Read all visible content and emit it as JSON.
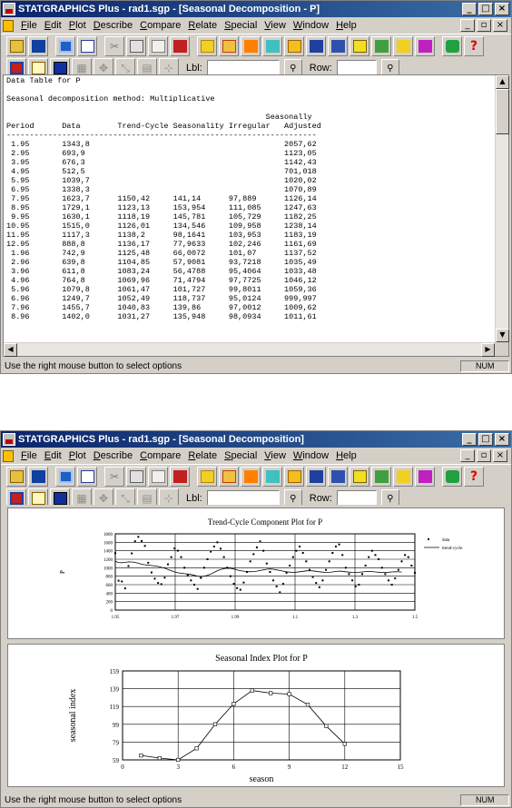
{
  "window1": {
    "title": "STATGRAPHICS Plus - rad1.sgp - [Seasonal Decomposition - P]",
    "status": "Use the right mouse button to select options",
    "num": "NUM"
  },
  "window2": {
    "title": "STATGRAPHICS Plus - rad1.sgp - [Seasonal Decomposition]",
    "status": "Use the right mouse button to select options",
    "num": "NUM"
  },
  "menu": [
    "File",
    "Edit",
    "Plot",
    "Describe",
    "Compare",
    "Relate",
    "Special",
    "View",
    "Window",
    "Help"
  ],
  "toolbar2": {
    "lbl": "Lbl:",
    "row": "Row:"
  },
  "text_table": {
    "title": "Data Table for P",
    "method": "Seasonal decomposition method: Multiplicative",
    "header1": "                                                        Seasonally",
    "header2": "Period      Data        Trend-Cycle Seasonality Irregular   Adjusted",
    "rule": "-------------------------------------------------------------------",
    "rows": [
      [
        " 1.95",
        "1343,8",
        "",
        "",
        "",
        "2057,62"
      ],
      [
        " 2.95",
        "693,9",
        "",
        "",
        "",
        "1123,05"
      ],
      [
        " 3.95",
        "676,3",
        "",
        "",
        "",
        "1142,43"
      ],
      [
        " 4.95",
        "512,5",
        "",
        "",
        "",
        "701,018"
      ],
      [
        " 5.95",
        "1039,7",
        "",
        "",
        "",
        "1020,02"
      ],
      [
        " 6.95",
        "1338,3",
        "",
        "",
        "",
        "1070,89"
      ],
      [
        " 7.95",
        "1623,7",
        "1150,42",
        "141,14",
        "97,889",
        "1126,14"
      ],
      [
        " 8.95",
        "1729,1",
        "1123,13",
        "153,954",
        "111,085",
        "1247,63"
      ],
      [
        " 9.95",
        "1630,1",
        "1118,19",
        "145,781",
        "105,729",
        "1182,25"
      ],
      [
        "10.95",
        "1515,0",
        "1126,01",
        "134,546",
        "109,958",
        "1238,14"
      ],
      [
        "11.95",
        "1117,3",
        "1138,2",
        "98,1641",
        "103,953",
        "1183,19"
      ],
      [
        "12.95",
        "888,8",
        "1136,17",
        "77,9633",
        "102,246",
        "1161,69"
      ],
      [
        " 1.96",
        "742,9",
        "1125,48",
        "66,0072",
        "101,07",
        "1137,52"
      ],
      [
        " 2.96",
        "639,8",
        "1104,85",
        "57,9081",
        "93,7218",
        "1035,49"
      ],
      [
        " 3.96",
        "611,8",
        "1083,24",
        "56,4788",
        "95,4064",
        "1033,48"
      ],
      [
        " 4.96",
        "764,8",
        "1069,96",
        "71,4794",
        "97,7725",
        "1046,12"
      ],
      [
        " 5.96",
        "1079,8",
        "1061,47",
        "101,727",
        "99,8011",
        "1059,36"
      ],
      [
        " 6.96",
        "1249,7",
        "1052,49",
        "118,737",
        "95,0124",
        "999,997"
      ],
      [
        " 7.96",
        "1455,7",
        "1040,83",
        "139,86",
        "97,0012",
        "1009,62"
      ],
      [
        " 8.96",
        "1402,0",
        "1031,27",
        "135,948",
        "98,0934",
        "1011,61"
      ]
    ]
  },
  "chart_data": [
    {
      "type": "scatter",
      "title": "Trend-Cycle Component Plot for P",
      "ylabel": "P",
      "xlabel": "",
      "x_ticks": [
        "1.95",
        "1.97",
        "1.99",
        "1.1",
        "1.3",
        "1.5"
      ],
      "y_ticks": [
        0,
        200,
        400,
        600,
        800,
        1000,
        1200,
        1400,
        1600,
        1800
      ],
      "ylim": [
        0,
        1800
      ],
      "grid": true,
      "legend_position": "right",
      "series": [
        {
          "name": "data",
          "values": [
            1344,
            694,
            676,
            513,
            1040,
            1338,
            1624,
            1729,
            1630,
            1515,
            1117,
            889,
            743,
            640,
            612,
            765,
            1080,
            1250,
            1456,
            1402,
            1250,
            1000,
            820,
            700,
            600,
            500,
            760,
            1000,
            1200,
            1380,
            1500,
            1600,
            1450,
            1250,
            1000,
            800,
            620,
            520,
            480,
            650,
            900,
            1150,
            1320,
            1480,
            1620,
            1400,
            1100,
            900,
            700,
            560,
            420,
            620,
            880,
            1050,
            1250,
            1400,
            1500,
            1350,
            1150,
            950,
            780,
            640,
            540,
            700,
            950,
            1150,
            1350,
            1500,
            1550,
            1300,
            1000,
            850,
            700,
            560,
            600,
            850,
            1050,
            1250,
            1400,
            1300,
            1200,
            1000,
            850,
            700,
            600,
            750,
            950,
            1150,
            1300,
            1250,
            1050,
            880
          ]
        },
        {
          "name": "trend-cycle",
          "values": [
            1150,
            1123,
            1118,
            1126,
            1138,
            1136,
            1125,
            1105,
            1083,
            1070,
            1061,
            1052,
            1041,
            1031,
            1010,
            990,
            960,
            930,
            900,
            880,
            870,
            860,
            850,
            840,
            820,
            800,
            790,
            800,
            820,
            850,
            890,
            930,
            960,
            980,
            990,
            985,
            970,
            950,
            930,
            920,
            910,
            905,
            910,
            920,
            935,
            950,
            965,
            970,
            965,
            950,
            935,
            920,
            905,
            895,
            890,
            895,
            905,
            915,
            925,
            930,
            925,
            915,
            905,
            895,
            890,
            892,
            900,
            912,
            920,
            915,
            905,
            895,
            890,
            888,
            892,
            900,
            908,
            912,
            908,
            900,
            894,
            890,
            890,
            894,
            900,
            904,
            902,
            898
          ]
        }
      ]
    },
    {
      "type": "line",
      "title": "Seasonal Index Plot for P",
      "xlabel": "season",
      "ylabel": "seasonal index",
      "x_ticks": [
        0,
        3,
        6,
        9,
        12,
        15
      ],
      "y_ticks": [
        59,
        79,
        99,
        119,
        139,
        159
      ],
      "xlim": [
        0,
        15
      ],
      "ylim": [
        59,
        159
      ],
      "grid": true,
      "x": [
        1,
        2,
        3,
        4,
        5,
        6,
        7,
        8,
        9,
        10,
        11,
        12
      ],
      "values": [
        64,
        61,
        59,
        72,
        99,
        122,
        137,
        134,
        133,
        121,
        97,
        77
      ]
    }
  ]
}
